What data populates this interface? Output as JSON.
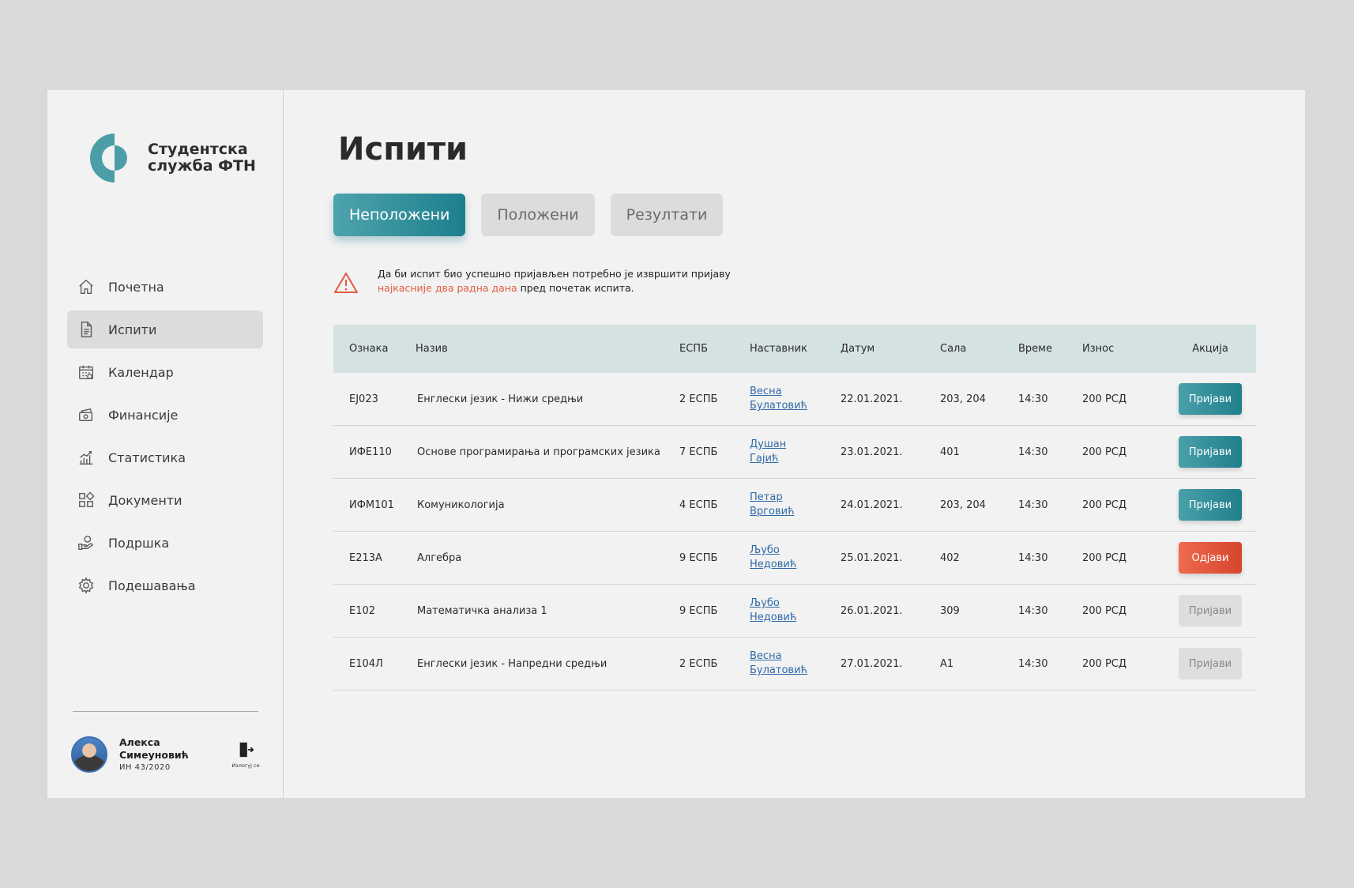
{
  "brand": {
    "line1": "Студентска",
    "line2": "служба ФТН"
  },
  "nav": [
    {
      "label": "Почетна",
      "icon": "home-icon"
    },
    {
      "label": "Испити",
      "icon": "document-icon",
      "active": true
    },
    {
      "label": "Календар",
      "icon": "calendar-icon"
    },
    {
      "label": "Финансије",
      "icon": "money-icon"
    },
    {
      "label": "Статистика",
      "icon": "chart-icon"
    },
    {
      "label": "Документи",
      "icon": "grid-icon"
    },
    {
      "label": "Подршка",
      "icon": "support-icon"
    },
    {
      "label": "Подешавања",
      "icon": "gear-icon"
    }
  ],
  "user": {
    "name": "Алекса Симеуновић",
    "id": "ИН 43/2020",
    "logout_label": "Излогуј се"
  },
  "page": {
    "title": "Испити"
  },
  "tabs": [
    {
      "label": "Неположени",
      "active": true
    },
    {
      "label": "Положени"
    },
    {
      "label": "Резултати"
    }
  ],
  "notice": {
    "line1": "Да би испит био успешно пријављен потребно је извршити пријаву",
    "highlight": "најкасније два радна дана",
    "rest": " пред почетак испита."
  },
  "table": {
    "headers": [
      "Ознака",
      "Назив",
      "ЕСПБ",
      "Наставник",
      "Датум",
      "Сала",
      "Време",
      "Износ",
      "Акција"
    ],
    "rows": [
      {
        "code": "EJ023",
        "name": "Енглески језик - Нижи средњи",
        "espb": "2 ЕСПБ",
        "teacher1": "Весна",
        "teacher2": "Булатовић",
        "date": "22.01.2021.",
        "room": "203, 204",
        "time": "14:30",
        "fee": "200 РСД",
        "action": "Пријави",
        "action_style": "primary"
      },
      {
        "code": "ИФЕ110",
        "name": "Основе програмирања и програмских језика",
        "espb": "7 ЕСПБ",
        "teacher1": "Душан",
        "teacher2": "Гајић",
        "date": "23.01.2021.",
        "room": "401",
        "time": "14:30",
        "fee": "200 РСД",
        "action": "Пријави",
        "action_style": "primary"
      },
      {
        "code": "ИФМ101",
        "name": "Комуникологија",
        "espb": "4 ЕСПБ",
        "teacher1": "Петар",
        "teacher2": "Врговић",
        "date": "24.01.2021.",
        "room": "203, 204",
        "time": "14:30",
        "fee": "200 РСД",
        "action": "Пријави",
        "action_style": "primary"
      },
      {
        "code": "E213A",
        "name": "Алгебра",
        "espb": "9 ЕСПБ",
        "teacher1": "Љубо",
        "teacher2": "Недовић",
        "date": "25.01.2021.",
        "room": "402",
        "time": "14:30",
        "fee": "200 РСД",
        "action": "Одјави",
        "action_style": "danger"
      },
      {
        "code": "E102",
        "name": "Математичка анализа 1",
        "espb": "9 ЕСПБ",
        "teacher1": "Љубо",
        "teacher2": "Недовић",
        "date": "26.01.2021.",
        "room": "309",
        "time": "14:30",
        "fee": "200 РСД",
        "action": "Пријави",
        "action_style": "disabled"
      },
      {
        "code": "E104Л",
        "name": "Енглески језик - Напредни средњи",
        "espb": "2 ЕСПБ",
        "teacher1": "Весна",
        "teacher2": "Булатовић",
        "date": "27.01.2021.",
        "room": "A1",
        "time": "14:30",
        "fee": "200 РСД",
        "action": "Пријави",
        "action_style": "disabled"
      }
    ]
  },
  "colors": {
    "accent": "#1f7f8b",
    "danger": "#d6452d",
    "header_bg": "#d4e2e2",
    "link": "#2f6aa8"
  }
}
